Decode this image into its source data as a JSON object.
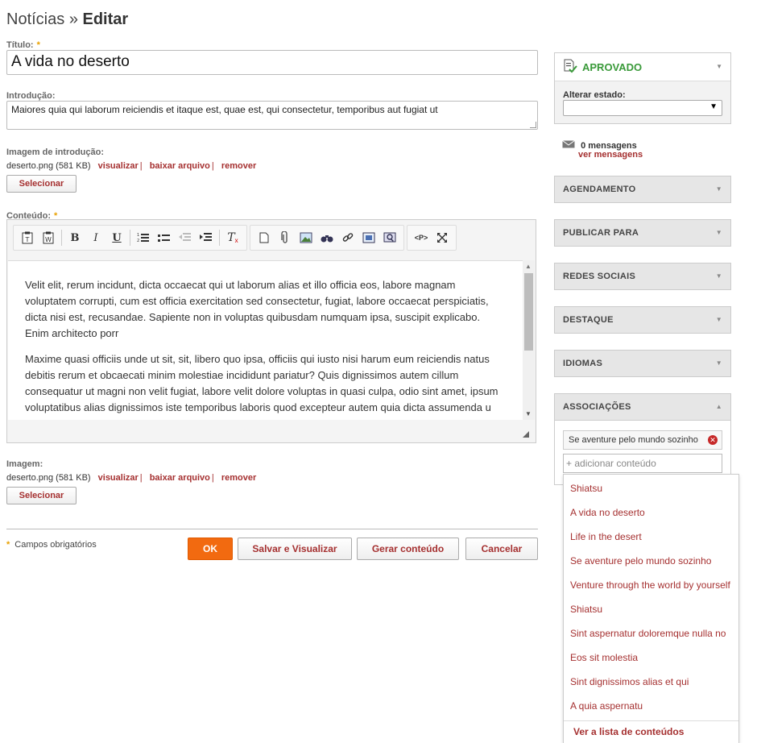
{
  "page": {
    "section": "Notícias",
    "separator": "»",
    "action": "Editar"
  },
  "form": {
    "titulo_label": "Título:",
    "titulo_value": "A vida no deserto",
    "intro_label": "Introdução:",
    "intro_value": "Maiores quia qui laborum reiciendis et itaque est, quae est, qui consectetur, temporibus aut fugiat ut",
    "intro_image_label": "Imagem de introdução:",
    "intro_image": {
      "file": "deserto.png (581 KB)",
      "view": "visualizar",
      "download": "baixar arquivo",
      "remove": "remover",
      "sep": "|"
    },
    "select_button": "Selecionar",
    "content_label": "Conteúdo:",
    "content_paragraphs": [
      "Velit elit, rerum incidunt, dicta occaecat qui ut laborum alias et illo officia eos, labore magnam voluptatem corrupti, cum est officia exercitation sed consectetur, fugiat, labore occaecat perspiciatis, dicta nisi est, recusandae. Sapiente non in voluptas quibusdam numquam ipsa, suscipit explicabo. Enim architecto porr",
      "Maxime quasi officiis unde ut sit, sit, libero quo ipsa, officiis qui iusto nisi harum eum reiciendis natus debitis rerum et obcaecati minim molestiae incididunt pariatur? Quis dignissimos autem cillum consequatur ut magni non velit fugiat, labore velit dolore voluptas in quasi culpa, odio sint amet, ipsum voluptatibus alias dignissimos iste temporibus laboris quod excepteur autem quia dicta assumenda u"
    ],
    "image_label": "Imagem:",
    "image": {
      "file": "deserto.png (581 KB)",
      "view": "visualizar",
      "download": "baixar arquivo",
      "remove": "remover",
      "sep": "|"
    },
    "required_marker": "*",
    "required_note": "Campos obrigatórios"
  },
  "toolbar": {
    "bold": "B",
    "italic": "I",
    "underline": "U",
    "source": "<P>",
    "clear_format": "Tx",
    "icons": [
      "paste-text-icon",
      "paste-word-icon",
      "bold-icon",
      "italic-icon",
      "underline-icon",
      "numbered-list-icon",
      "bulleted-list-icon",
      "outdent-icon",
      "indent-icon",
      "remove-format-icon",
      "new-page-icon",
      "attachment-icon",
      "image-icon",
      "find-icon",
      "link-icon",
      "embed-icon",
      "preview-icon",
      "source-icon",
      "maximize-icon"
    ]
  },
  "buttons": {
    "ok": "OK",
    "save_preview": "Salvar e Visualizar",
    "generate": "Gerar conteúdo",
    "cancel": "Cancelar"
  },
  "sidebar": {
    "status": "APROVADO",
    "change_state_label": "Alterar estado:",
    "messages_count": "0 mensagens",
    "messages_link": "ver mensagens",
    "panels": [
      "AGENDAMENTO",
      "PUBLICAR PARA",
      "REDES SOCIAIS",
      "DESTAQUE",
      "IDIOMAS",
      "ASSOCIAÇÕES"
    ],
    "association_tag": "Se aventure pelo mundo sozinho",
    "add_placeholder": "+ adicionar conteúdo",
    "suggestions": [
      "Shiatsu",
      "A vida no deserto",
      "Life in the desert",
      "Se aventure pelo mundo sozinho",
      "Venture through the world by yourself",
      "Shiatsu",
      "Sint aspernatur doloremque nulla no",
      "Eos sit molestia",
      "Sint dignissimos alias et qui",
      "A quia aspernatu"
    ],
    "see_list": "Ver a lista de conteúdos"
  },
  "colors": {
    "accent": "#a53030",
    "approved": "#3a9a3a",
    "ok_button": "#f26a10",
    "required": "#e8a000"
  }
}
